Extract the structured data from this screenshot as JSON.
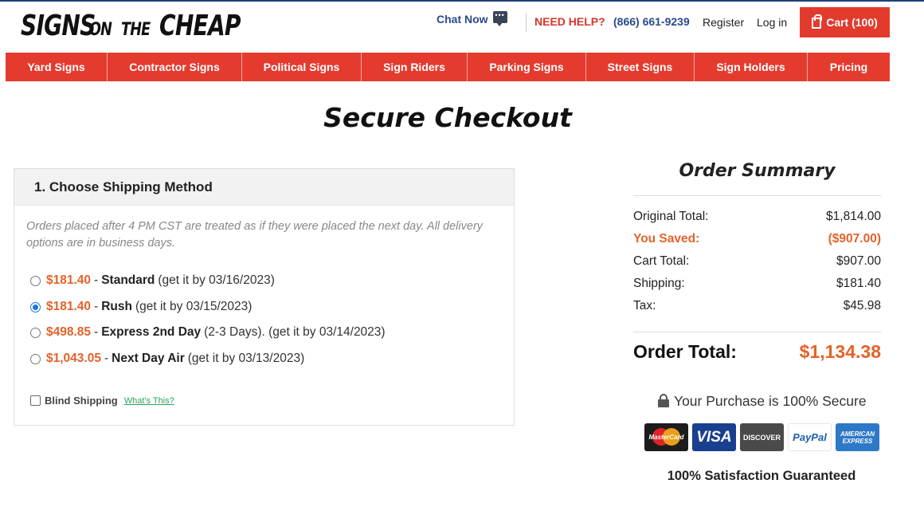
{
  "header": {
    "logo": [
      "SIGNS",
      "ON",
      "THE",
      "CHEAP"
    ],
    "chat_label": "Chat Now",
    "chat_icon": "chat-bubble-icon",
    "need_help": "NEED HELP?",
    "phone": "(866) 661-9239",
    "register": "Register",
    "login": "Log in",
    "cart": "Cart (100)",
    "accent_color": "#e43b2e"
  },
  "nav": [
    "Yard Signs",
    "Contractor Signs",
    "Political Signs",
    "Sign Riders",
    "Parking Signs",
    "Street Signs",
    "Sign Holders",
    "Pricing"
  ],
  "page_title": "Secure Checkout",
  "shipping": {
    "heading": "1. Choose Shipping Method",
    "note": "Orders placed after 4 PM CST are treated as if they were placed the next day. All delivery options are in business days.",
    "options": [
      {
        "price": "$181.40",
        "name": "Standard",
        "detail": "(get it by 03/16/2023)",
        "selected": false
      },
      {
        "price": "$181.40",
        "name": "Rush",
        "detail": "(get it by 03/15/2023)",
        "selected": true
      },
      {
        "price": "$498.85",
        "name": "Express 2nd Day",
        "detail": "(2-3 Days). (get it by 03/14/2023)",
        "selected": false
      },
      {
        "price": "$1,043.05",
        "name": "Next Day Air",
        "detail": "(get it by 03/13/2023)",
        "selected": false
      }
    ],
    "separator": "-",
    "blind_label": "Blind Shipping",
    "blind_checked": false,
    "whats_this": "What's This?"
  },
  "summary": {
    "title": "Order Summary",
    "rows": [
      {
        "label": "Original Total:",
        "value": "$1,814.00"
      },
      {
        "label": "You Saved:",
        "value": "($907.00)"
      },
      {
        "label": "Cart Total:",
        "value": "$907.00"
      },
      {
        "label": "Shipping:",
        "value": "$181.40"
      },
      {
        "label": "Tax:",
        "value": "$45.98"
      }
    ],
    "total_label": "Order Total:",
    "total_value": "$1,134.38",
    "secure_text": "Your Purchase is 100% Secure",
    "cards": {
      "mastercard": "MasterCard",
      "visa": "VISA",
      "discover": "DISCOVER",
      "paypal": "PayPal",
      "amex_line1": "AMERICAN",
      "amex_line2": "EXPRESS"
    },
    "guarantee": "100% Satisfaction Guaranteed"
  }
}
